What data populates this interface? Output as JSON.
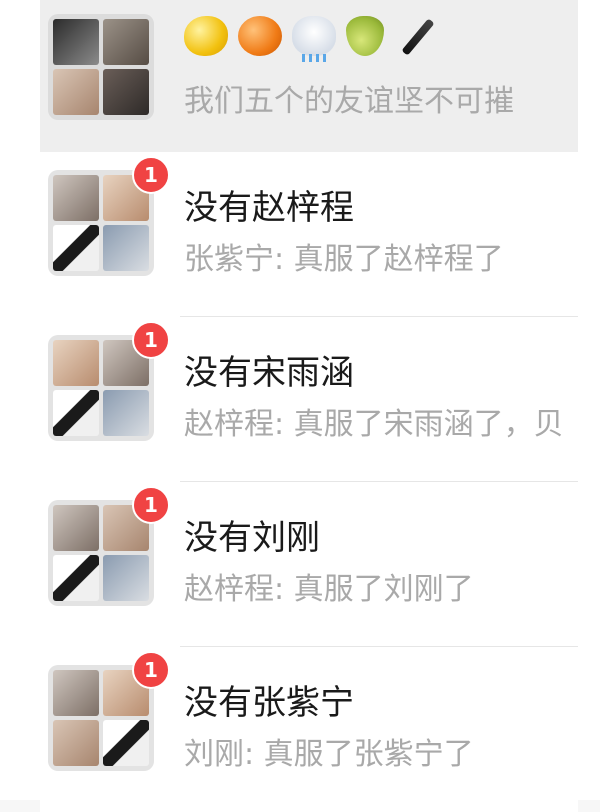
{
  "chats": [
    {
      "title_emojis": [
        "lemon-icon",
        "orange-icon",
        "rain-cloud-icon",
        "pear-icon",
        "fountain-pen-icon"
      ],
      "preview": "我们五个的友谊坚不可摧",
      "pinned": true
    },
    {
      "title": "没有赵梓程",
      "preview": "张紫宁: 真服了赵梓程了",
      "badge": "1"
    },
    {
      "title": "没有宋雨涵",
      "preview": "赵梓程: 真服了宋雨涵了，贝",
      "badge": "1"
    },
    {
      "title": "没有刘刚",
      "preview": "赵梓程: 真服了刘刚了",
      "badge": "1"
    },
    {
      "title": "没有张紫宁",
      "preview": "刘刚: 真服了张紫宁了",
      "badge": "1"
    }
  ]
}
